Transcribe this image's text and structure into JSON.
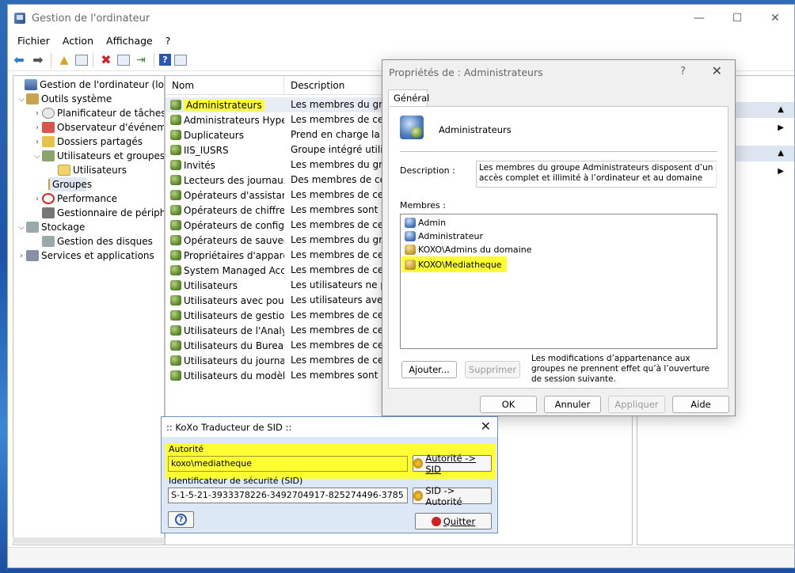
{
  "window": {
    "title": "Gestion de l'ordinateur"
  },
  "menu": [
    "Fichier",
    "Action",
    "Affichage",
    "?"
  ],
  "tree": [
    {
      "label": "Gestion de l'ordinateur (local)",
      "level": 0,
      "icon": "computer-management-icon",
      "exp": ""
    },
    {
      "label": "Outils système",
      "level": 1,
      "icon": "tools-icon",
      "exp": "v"
    },
    {
      "label": "Planificateur de tâches",
      "level": 2,
      "icon": "clock-icon",
      "exp": ">"
    },
    {
      "label": "Observateur d'événeme",
      "level": 2,
      "icon": "event-log-icon",
      "exp": ">"
    },
    {
      "label": "Dossiers partagés",
      "level": 2,
      "icon": "shared-folder-icon",
      "exp": ">"
    },
    {
      "label": "Utilisateurs et groupes l",
      "level": 2,
      "icon": "users-groups-icon",
      "exp": "v"
    },
    {
      "label": "Utilisateurs",
      "level": 3,
      "icon": "folder-icon",
      "exp": ""
    },
    {
      "label": "Groupes",
      "level": 3,
      "icon": "folder-icon",
      "exp": "",
      "selected": true
    },
    {
      "label": "Performance",
      "level": 2,
      "icon": "performance-icon",
      "exp": ">"
    },
    {
      "label": "Gestionnaire de périphé",
      "level": 2,
      "icon": "device-manager-icon",
      "exp": ""
    },
    {
      "label": "Stockage",
      "level": 1,
      "icon": "storage-icon",
      "exp": "v"
    },
    {
      "label": "Gestion des disques",
      "level": 2,
      "icon": "disk-icon",
      "exp": ""
    },
    {
      "label": "Services et applications",
      "level": 1,
      "icon": "services-icon",
      "exp": ">"
    }
  ],
  "list": {
    "columns": [
      "Nom",
      "Description"
    ],
    "rows": [
      {
        "name": "Administrateurs",
        "desc": "Les membres du group",
        "highlight": true
      },
      {
        "name": "Administrateurs Hype...",
        "desc": "Les membres de ce gr"
      },
      {
        "name": "Duplicateurs",
        "desc": "Prend en charge la rép"
      },
      {
        "name": "IIS_IUSRS",
        "desc": "Groupe intégré utilisé"
      },
      {
        "name": "Invités",
        "desc": "Les membres du group"
      },
      {
        "name": "Lecteurs des journaux...",
        "desc": "Des membres de ce gro"
      },
      {
        "name": "Opérateurs d'assistan...",
        "desc": "Les membres de ce gr"
      },
      {
        "name": "Opérateurs de chiffre...",
        "desc": "Les membres sont aut"
      },
      {
        "name": "Opérateurs de config...",
        "desc": "Les membres de ce gr"
      },
      {
        "name": "Opérateurs de sauveg...",
        "desc": "Les membres du group"
      },
      {
        "name": "Propriétaires d'appareils",
        "desc": "Les membres de ce gr"
      },
      {
        "name": "System Managed Acc...",
        "desc": "Les membres de ce gr"
      },
      {
        "name": "Utilisateurs",
        "desc": "Les utilisateurs ne peu"
      },
      {
        "name": "Utilisateurs avec pouv...",
        "desc": "Les utilisateurs avec p"
      },
      {
        "name": "Utilisateurs de gestion...",
        "desc": "Les membres de ce gr"
      },
      {
        "name": "Utilisateurs de l'Analy...",
        "desc": "Les membres de ce gr"
      },
      {
        "name": "Utilisateurs du Bureau...",
        "desc": "Les membres de ce gr"
      },
      {
        "name": "Utilisateurs du journal...",
        "desc": "Les membres de ce gr"
      },
      {
        "name": "Utilisateurs du modèl...",
        "desc": "Les membres sont aut"
      }
    ]
  },
  "props": {
    "title": "Propriétés de : Administrateurs",
    "help": "?",
    "close": "✕",
    "tab": "Général",
    "group_name": "Administrateurs",
    "desc_label": "Description :",
    "desc_value": "Les membres du groupe Administrateurs disposent d’un accès complet et illimité à l’ordinateur et au domaine",
    "members_label": "Membres :",
    "members": [
      {
        "name": "Admin",
        "type": "user"
      },
      {
        "name": "Administrateur",
        "type": "user"
      },
      {
        "name": "KOXO\\Admins du domaine",
        "type": "group"
      },
      {
        "name": "KOXO\\Mediatheque",
        "type": "group",
        "highlight": true
      }
    ],
    "btn_add": "Ajouter...",
    "btn_remove": "Supprimer",
    "note": "Les modifications d’appartenance aux groupes ne prennent effet qu’à l’ouverture de session suivante.",
    "btn_ok": "OK",
    "btn_cancel": "Annuler",
    "btn_apply": "Appliquer",
    "btn_help": "Aide"
  },
  "koxo": {
    "title": ":: KoXo Traducteur de SID ::",
    "close": "✕",
    "authority_label": "Autorité",
    "authority_value": "koxo\\mediatheque",
    "btn_to_sid": "Autorité -> SID",
    "sid_label": "Identificateur de sécurité (SID)",
    "sid_value": "S-1-5-21-3933378226-3492704917-825274496-3785",
    "btn_to_authority": "SID -> Autorité",
    "btn_help": "?",
    "btn_quit": "Quitter"
  },
  "colors": {
    "highlight": "#ffff33",
    "accent": "#2b7bd4"
  }
}
